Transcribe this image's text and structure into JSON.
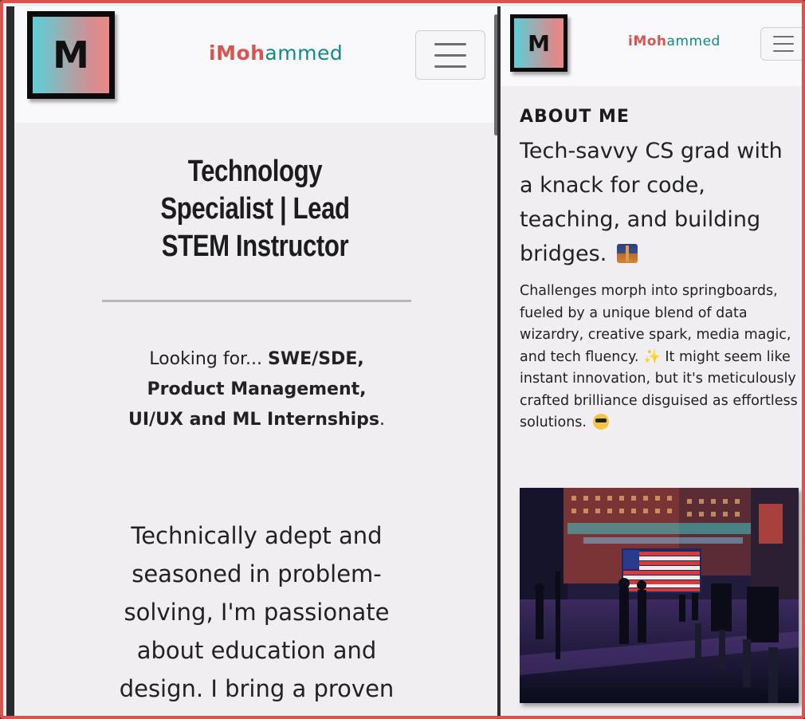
{
  "brand": {
    "logo_letter": "M",
    "name_accent": "iMoh",
    "name_rest": "ammed"
  },
  "colors": {
    "accent_red": "#d9534f",
    "accent_teal": "#0f8a89",
    "frame_border": "#d9534f"
  },
  "left": {
    "hero_title": "Technology Specialist | Lead STEM Instructor",
    "looking_prefix": "Looking for... ",
    "looking_roles_1": "SWE/SDE,",
    "looking_roles_2": "Product Management,",
    "looking_roles_3": "UI/UX and ML Internships",
    "looking_suffix": ".",
    "pitch": "Technically adept and seasoned in problem-solving, I'm passionate about education and design. I bring a proven ability to wield"
  },
  "right": {
    "about_heading": "ABOUT ME",
    "about_lead": "Tech-savvy CS grad with a knack for code, teaching, and building bridges.",
    "about_body_1": "Challenges morph into springboards, fueled by a unique blend of data wizardry, creative spark, media magic, and tech fluency.",
    "about_spark": "✨",
    "about_body_2": " It might seem like instant innovation, but it's meticulously crafted brilliance disguised as effortless solutions."
  },
  "icons": {
    "menu": "hamburger-icon",
    "bridge": "bridge-at-night-icon",
    "sparkles": "sparkles-icon",
    "sunglasses": "smiling-face-with-sunglasses-icon"
  }
}
